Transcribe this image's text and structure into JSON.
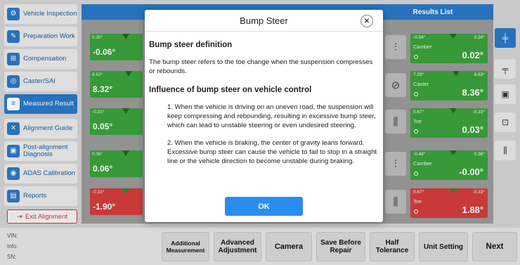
{
  "sidebar": {
    "items": [
      {
        "label": "Vehicle Inspection",
        "icon": "car-inspect-icon"
      },
      {
        "label": "Preparation Work",
        "icon": "wrench-icon"
      },
      {
        "label": "Compensation",
        "icon": "compensation-icon"
      },
      {
        "label": "Caster/SAI",
        "icon": "steering-wheel-icon"
      },
      {
        "label": "Measured Result",
        "icon": "list-icon"
      },
      {
        "label": "Alignment Guide",
        "icon": "tools-icon"
      },
      {
        "label": "Post-alignment Diagnosis",
        "icon": "car-icon"
      },
      {
        "label": "ADAS Calibration",
        "icon": "adas-icon"
      },
      {
        "label": "Reports",
        "icon": "report-icon"
      }
    ],
    "exit_label": "Exit Alignment"
  },
  "main": {
    "results_title": "Results List",
    "left_gauges": [
      {
        "scale_left": "0.30°",
        "value": "-0.06°",
        "color": "#3aa23a"
      },
      {
        "scale_left": "8.63°",
        "value": "8.32°",
        "color": "#3aa23a"
      },
      {
        "scale_left": "-0.33°",
        "value": "0.05°",
        "color": "#3aa23a"
      },
      {
        "scale_left": "0.36°",
        "value": "0.06°",
        "color": "#3aa23a"
      },
      {
        "scale_left": "-0.33°",
        "value": "-1.90°",
        "color": "#d43d3d"
      }
    ],
    "right_cards": [
      {
        "left": "-0.54°",
        "right": "0.30°",
        "label": "Camber",
        "value": "0.02°",
        "color": "#3aa23a"
      },
      {
        "left": "7.29°",
        "right": "8.63°",
        "label": "Caster",
        "value": "8.36°",
        "color": "#3aa23a"
      },
      {
        "left": "0.67°",
        "right": "-0.33°",
        "label": "Toe",
        "value": "0.03°",
        "color": "#3aa23a"
      },
      {
        "left": "-0.48°",
        "right": "0.36°",
        "label": "Camber",
        "value": "-0.00°",
        "color": "#3aa23a"
      },
      {
        "left": "0.67°",
        "right": "-0.33°",
        "label": "Toe",
        "value": "1.88°",
        "color": "#d43d3d"
      }
    ]
  },
  "footer": {
    "vin_label": "VIN:",
    "info_label": "Info:",
    "sn_label": "SN:",
    "buttons": [
      "Additional Measurement",
      "Advanced Adjustment",
      "Camera",
      "Save Before Repair",
      "Half Tolerance",
      "Unit Setting",
      "Next"
    ]
  },
  "modal": {
    "title": "Bump Steer",
    "close_glyph": "✕",
    "definition_heading": "Bump steer definition",
    "definition_text": "The bump steer refers to the toe change when the suspension compresses or rebounds.",
    "influence_heading": "Influence of bump steer on vehicle control",
    "points": [
      "1. When the vehicle is driving on an uneven road, the suspension will keep compressing and rebounding, resulting in excessive bump steer, which can lead to unstable steering or even undesired steering.",
      "2. When the vehicle is braking, the center of gravity leans forward. Excessive bump steer can cause the vehicle to fail to stop in a straight line or the vehicle direction to become unstable during braking."
    ],
    "ok_label": "OK"
  },
  "colors": {
    "accent": "#2b79c7",
    "ok_button": "#2b8cf0",
    "in_range": "#3aa23a",
    "out_of_range": "#d43d3d"
  }
}
